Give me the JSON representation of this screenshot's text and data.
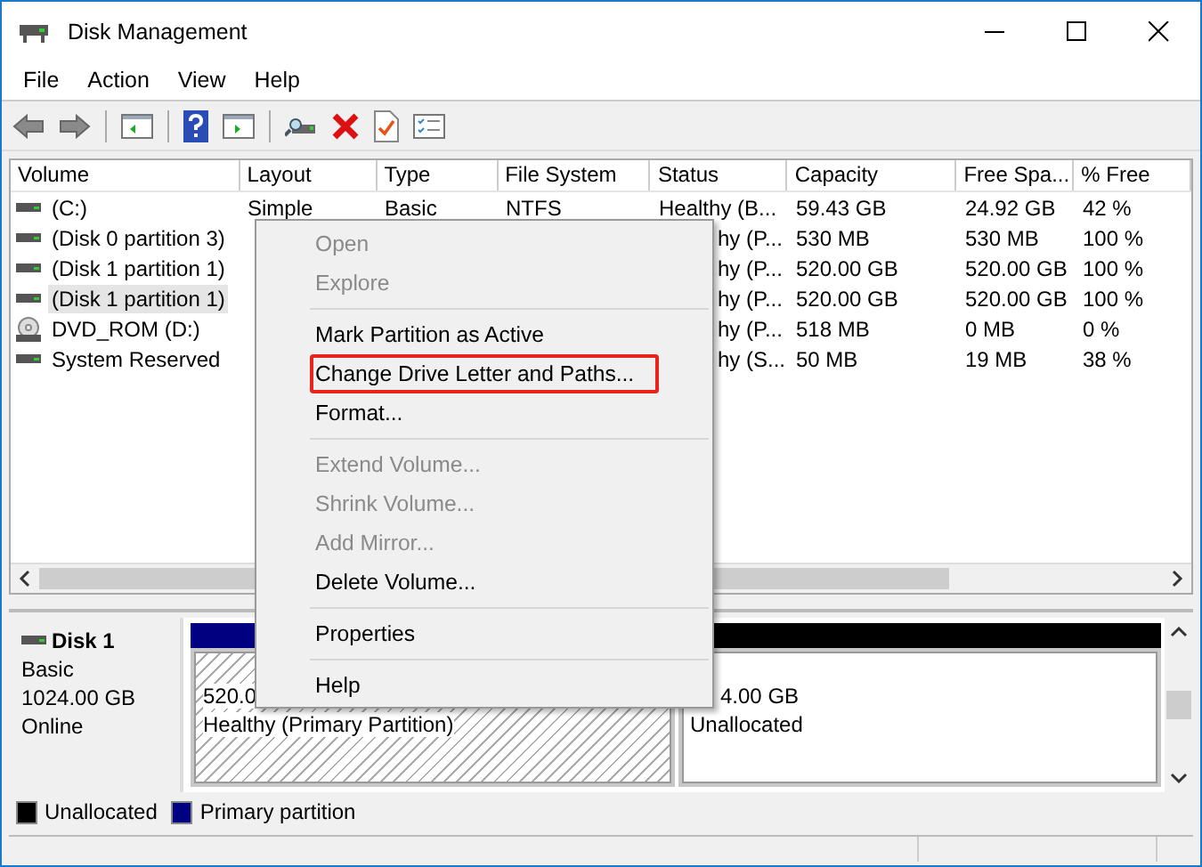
{
  "window": {
    "title": "Disk Management"
  },
  "menu_bar": [
    "File",
    "Action",
    "View",
    "Help"
  ],
  "toolbar": [
    {
      "kind": "back"
    },
    {
      "kind": "forward"
    },
    {
      "kind": "sep"
    },
    {
      "kind": "tree"
    },
    {
      "kind": "sep"
    },
    {
      "kind": "help"
    },
    {
      "kind": "pane"
    },
    {
      "kind": "sep"
    },
    {
      "kind": "connect"
    },
    {
      "kind": "delete"
    },
    {
      "kind": "properties"
    },
    {
      "kind": "checklist"
    }
  ],
  "table": {
    "columns": [
      "Volume",
      "Layout",
      "Type",
      "File System",
      "Status",
      "Capacity",
      "Free Spa...",
      "% Free"
    ],
    "rows": [
      {
        "kind": "disk",
        "selected": false,
        "under_menu": false,
        "volume": "(C:)",
        "layout": "Simple",
        "type": "Basic",
        "file_system": "NTFS",
        "status": "Healthy (B...",
        "capacity": "59.43 GB",
        "free_space": "24.92 GB",
        "percent_free": "42 %"
      },
      {
        "kind": "disk",
        "selected": false,
        "under_menu": true,
        "volume": "(Disk 0 partition 3)",
        "status": "hy (P...",
        "capacity": "530 MB",
        "free_space": "530 MB",
        "percent_free": "100 %"
      },
      {
        "kind": "disk",
        "selected": false,
        "under_menu": true,
        "volume": "(Disk 1 partition 1)",
        "status": "hy (P...",
        "capacity": "520.00 GB",
        "free_space": "520.00 GB",
        "percent_free": "100 %"
      },
      {
        "kind": "disk",
        "selected": true,
        "under_menu": true,
        "volume": "(Disk 1 partition 1)",
        "status": "hy (P...",
        "capacity": "520.00 GB",
        "free_space": "520.00 GB",
        "percent_free": "100 %"
      },
      {
        "kind": "dvd",
        "selected": false,
        "under_menu": true,
        "volume": "DVD_ROM (D:)",
        "status": "hy (P...",
        "capacity": "518 MB",
        "free_space": "0 MB",
        "percent_free": "0 %"
      },
      {
        "kind": "disk",
        "selected": false,
        "under_menu": true,
        "volume": "System Reserved",
        "status": "hy (S...",
        "capacity": "50 MB",
        "free_space": "19 MB",
        "percent_free": "38 %"
      }
    ]
  },
  "context_menu": [
    {
      "kind": "item",
      "label": "Open",
      "disabled": true,
      "highlighted": false
    },
    {
      "kind": "item",
      "label": "Explore",
      "disabled": true,
      "highlighted": false
    },
    {
      "kind": "sep"
    },
    {
      "kind": "item",
      "label": "Mark Partition as Active",
      "disabled": false,
      "highlighted": false
    },
    {
      "kind": "item",
      "label": "Change Drive Letter and Paths...",
      "disabled": false,
      "highlighted": true
    },
    {
      "kind": "item",
      "label": "Format...",
      "disabled": false,
      "highlighted": false
    },
    {
      "kind": "sep"
    },
    {
      "kind": "item",
      "label": "Extend Volume...",
      "disabled": true,
      "highlighted": false
    },
    {
      "kind": "item",
      "label": "Shrink Volume...",
      "disabled": true,
      "highlighted": false
    },
    {
      "kind": "item",
      "label": "Add Mirror...",
      "disabled": true,
      "highlighted": false
    },
    {
      "kind": "item",
      "label": "Delete Volume...",
      "disabled": false,
      "highlighted": false
    },
    {
      "kind": "sep"
    },
    {
      "kind": "item",
      "label": "Properties",
      "disabled": false,
      "highlighted": false
    },
    {
      "kind": "sep"
    },
    {
      "kind": "item",
      "label": "Help",
      "disabled": false,
      "highlighted": false
    }
  ],
  "disk": {
    "name": "Disk 1",
    "type": "Basic",
    "size": "1024.00 GB",
    "status": "Online",
    "partitions": [
      {
        "kind": "primary",
        "color": "#000080",
        "size": "520.0",
        "status": "Healthy (Primary Partition)"
      },
      {
        "kind": "unallocated",
        "color": "#000000",
        "size": "4.00 GB",
        "status": "Unallocated"
      }
    ]
  },
  "legend": [
    {
      "label": "Unallocated",
      "color": "#000000"
    },
    {
      "label": "Primary partition",
      "color": "#000080"
    }
  ]
}
